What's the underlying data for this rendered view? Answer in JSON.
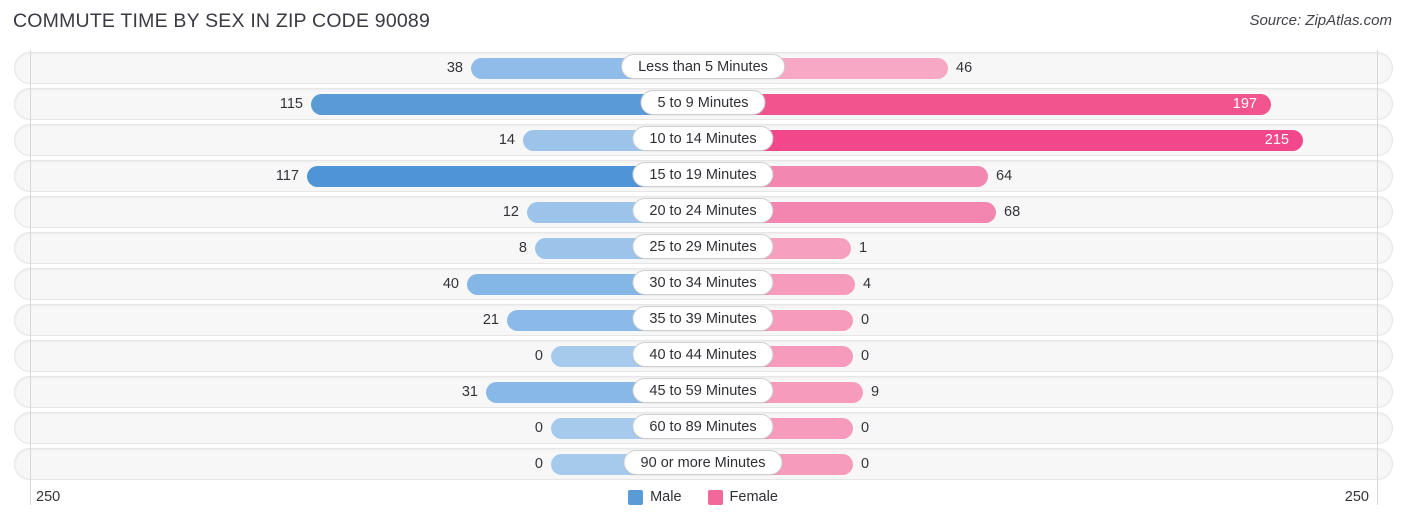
{
  "header": {
    "title": "COMMUTE TIME BY SEX IN ZIP CODE 90089",
    "source": "Source: ZipAtlas.com"
  },
  "axis": {
    "left_end": "250",
    "right_end": "250"
  },
  "legend": {
    "items": [
      {
        "label": "Male",
        "color": "#5b9bd5"
      },
      {
        "label": "Female",
        "color": "#f2689b"
      }
    ]
  },
  "chart_data": {
    "type": "bar",
    "title": "COMMUTE TIME BY SEX IN ZIP CODE 90089",
    "subtitle": "Source: ZipAtlas.com",
    "orientation": "horizontal-diverging",
    "xlabel": "",
    "ylabel": "",
    "xlim": [
      -250,
      250
    ],
    "axis_ticks": [
      "250",
      "250"
    ],
    "grid": false,
    "legend_position": "bottom-center",
    "categories": [
      "Less than 5 Minutes",
      "5 to 9 Minutes",
      "10 to 14 Minutes",
      "15 to 19 Minutes",
      "20 to 24 Minutes",
      "25 to 29 Minutes",
      "30 to 34 Minutes",
      "35 to 39 Minutes",
      "40 to 44 Minutes",
      "45 to 59 Minutes",
      "60 to 89 Minutes",
      "90 or more Minutes"
    ],
    "series": [
      {
        "name": "Male",
        "color": "#5b9bd5",
        "values": [
          38,
          115,
          14,
          117,
          12,
          8,
          40,
          21,
          0,
          31,
          0,
          0
        ]
      },
      {
        "name": "Female",
        "color": "#f2689b",
        "values": [
          46,
          197,
          215,
          64,
          68,
          1,
          4,
          0,
          0,
          9,
          0,
          0
        ]
      }
    ]
  },
  "rows": [
    {
      "label": "Less than 5 Minutes",
      "male": "38",
      "female": "46",
      "male_w": 232,
      "female_w": 245,
      "male_color": "#8fbce8",
      "female_color": "#f7a8c4",
      "male_inside": false,
      "female_inside": false
    },
    {
      "label": "5 to 9 Minutes",
      "male": "115",
      "female": "197",
      "male_w": 392,
      "female_w": 568,
      "male_color": "#5b9bd5",
      "female_color": "#f2548d",
      "male_inside": false,
      "female_inside": true
    },
    {
      "label": "10 to 14 Minutes",
      "male": "14",
      "female": "215",
      "male_w": 180,
      "female_w": 600,
      "male_color": "#9cc4ea",
      "female_color": "#f2478a",
      "male_inside": false,
      "female_inside": true
    },
    {
      "label": "15 to 19 Minutes",
      "male": "117",
      "female": "64",
      "male_w": 396,
      "female_w": 285,
      "male_color": "#4e95d8",
      "female_color": "#f288b2",
      "male_inside": false,
      "female_inside": false
    },
    {
      "label": "20 to 24 Minutes",
      "male": "12",
      "female": "68",
      "male_w": 176,
      "female_w": 293,
      "male_color": "#9cc4ea",
      "female_color": "#f286b0",
      "male_inside": false,
      "female_inside": false
    },
    {
      "label": "25 to 29 Minutes",
      "male": "8",
      "female": "1",
      "male_w": 168,
      "female_w": 148,
      "male_color": "#9cc4ea",
      "female_color": "#f6a0bf",
      "male_inside": false,
      "female_inside": false
    },
    {
      "label": "30 to 34 Minutes",
      "male": "40",
      "female": "4",
      "male_w": 236,
      "female_w": 152,
      "male_color": "#84b6e6",
      "female_color": "#f69bbc",
      "male_inside": false,
      "female_inside": false
    },
    {
      "label": "35 to 39 Minutes",
      "male": "21",
      "female": "0",
      "male_w": 196,
      "female_w": 150,
      "male_color": "#8cbae8",
      "female_color": "#f69bbc",
      "male_inside": false,
      "female_inside": false
    },
    {
      "label": "40 to 44 Minutes",
      "male": "0",
      "female": "0",
      "male_w": 152,
      "female_w": 150,
      "male_color": "#a6caec",
      "female_color": "#f69bbc",
      "male_inside": false,
      "female_inside": false
    },
    {
      "label": "45 to 59 Minutes",
      "male": "31",
      "female": "9",
      "male_w": 217,
      "female_w": 160,
      "male_color": "#88b8e7",
      "female_color": "#f69bbc",
      "male_inside": false,
      "female_inside": false
    },
    {
      "label": "60 to 89 Minutes",
      "male": "0",
      "female": "0",
      "male_w": 152,
      "female_w": 150,
      "male_color": "#a6caec",
      "female_color": "#f69bbc",
      "male_inside": false,
      "female_inside": false
    },
    {
      "label": "90 or more Minutes",
      "male": "0",
      "female": "0",
      "male_w": 152,
      "female_w": 150,
      "male_color": "#a6caec",
      "female_color": "#f69bbc",
      "male_inside": false,
      "female_inside": false
    }
  ]
}
